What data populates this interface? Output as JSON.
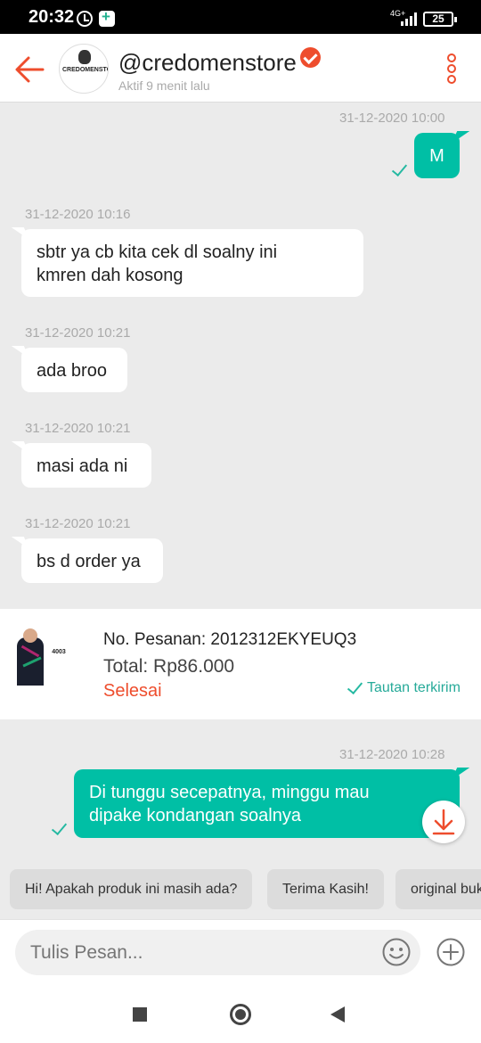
{
  "status_bar": {
    "time": "20:32",
    "network": "4G+",
    "battery": "25"
  },
  "header": {
    "shop_name": "@credomenstore",
    "status": "Aktif 9 menit lalu",
    "avatar_text": "CREDOMENSTORE",
    "accent_color": "#ee4d2d"
  },
  "messages": [
    {
      "timestamp": "31-12-2020 10:00",
      "text": "M",
      "direction": "out"
    },
    {
      "timestamp": "31-12-2020 10:16",
      "lines": [
        "sbtr ya cb kita cek dl soalny ini",
        "kmren dah kosong"
      ],
      "direction": "in"
    },
    {
      "timestamp": "31-12-2020 10:21",
      "text": "ada broo",
      "direction": "in"
    },
    {
      "timestamp": "31-12-2020 10:21",
      "text": "masi ada ni",
      "direction": "in"
    },
    {
      "timestamp": "31-12-2020 10:21",
      "text": "bs d order ya",
      "direction": "in"
    },
    {
      "timestamp": "31-12-2020 10:28",
      "lines": [
        "Di tunggu secepatnya, minggu mau",
        "dipake kondangan soalnya"
      ],
      "direction": "out"
    }
  ],
  "order": {
    "number": "No. Pesanan: 2012312EKYEUQ3",
    "total": "Total: Rp86.000",
    "status": "Selesai",
    "link_status": "Tautan terkirim",
    "product_code": "4003"
  },
  "quick_replies": [
    "Hi! Apakah produk ini masih ada?",
    "Terima Kasih!",
    "original bukan?"
  ],
  "input": {
    "placeholder": "Tulis Pesan..."
  },
  "colors": {
    "outgoing_bubble": "#00bfa5",
    "incoming_bubble": "#ffffff",
    "background": "#ebebeb",
    "order_status": "#ee4d2d",
    "link_status": "#26aa99"
  }
}
